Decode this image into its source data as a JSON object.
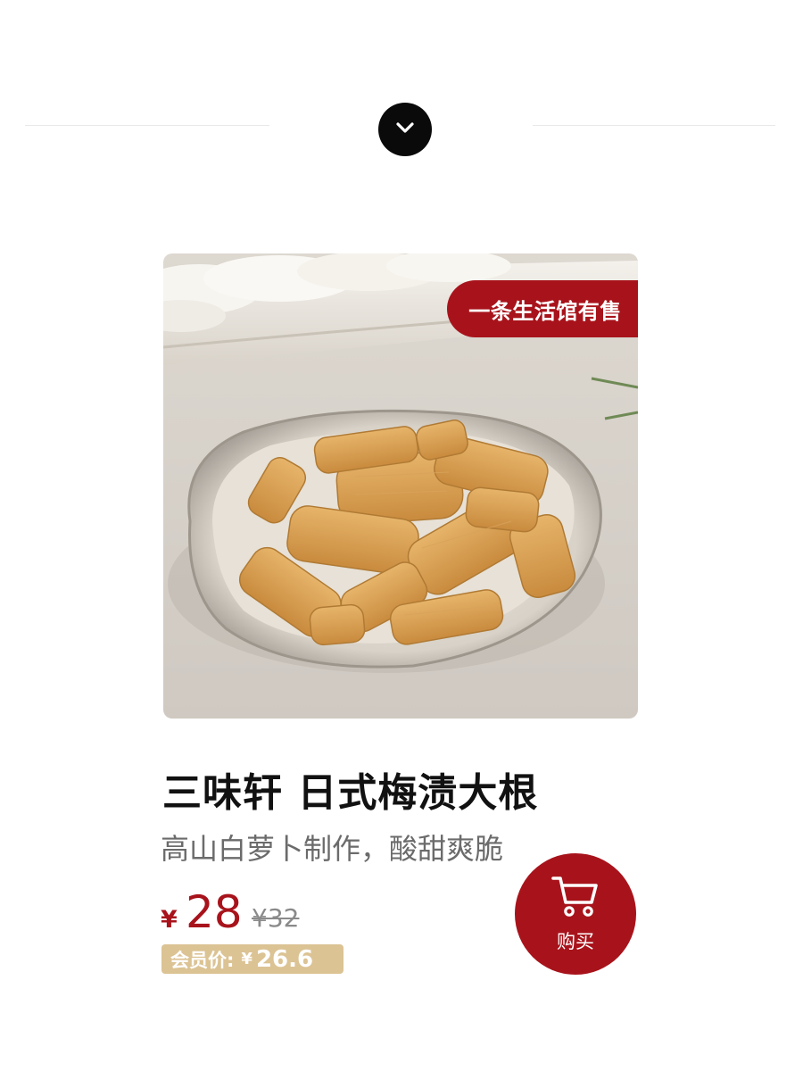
{
  "product": {
    "seller_badge": "一条生活馆有售",
    "title": "三味轩 日式梅渍大根",
    "subtitle": "高山白萝卜制作，酸甜爽脆",
    "price": {
      "currency": "¥",
      "current": "28",
      "original": "¥32"
    },
    "member_price": {
      "label": "会员价:",
      "currency": "¥",
      "value": "26.6"
    },
    "image_icon": "pickled-radish-plate-photo"
  },
  "buy_button": {
    "label": "购买",
    "icon": "shopping-cart-icon"
  },
  "scroll_indicator": {
    "icon": "chevron-down-icon"
  },
  "colors": {
    "accent": "#a8131b",
    "member_badge": "#dcc394",
    "indicator": "#0a0a0a"
  }
}
